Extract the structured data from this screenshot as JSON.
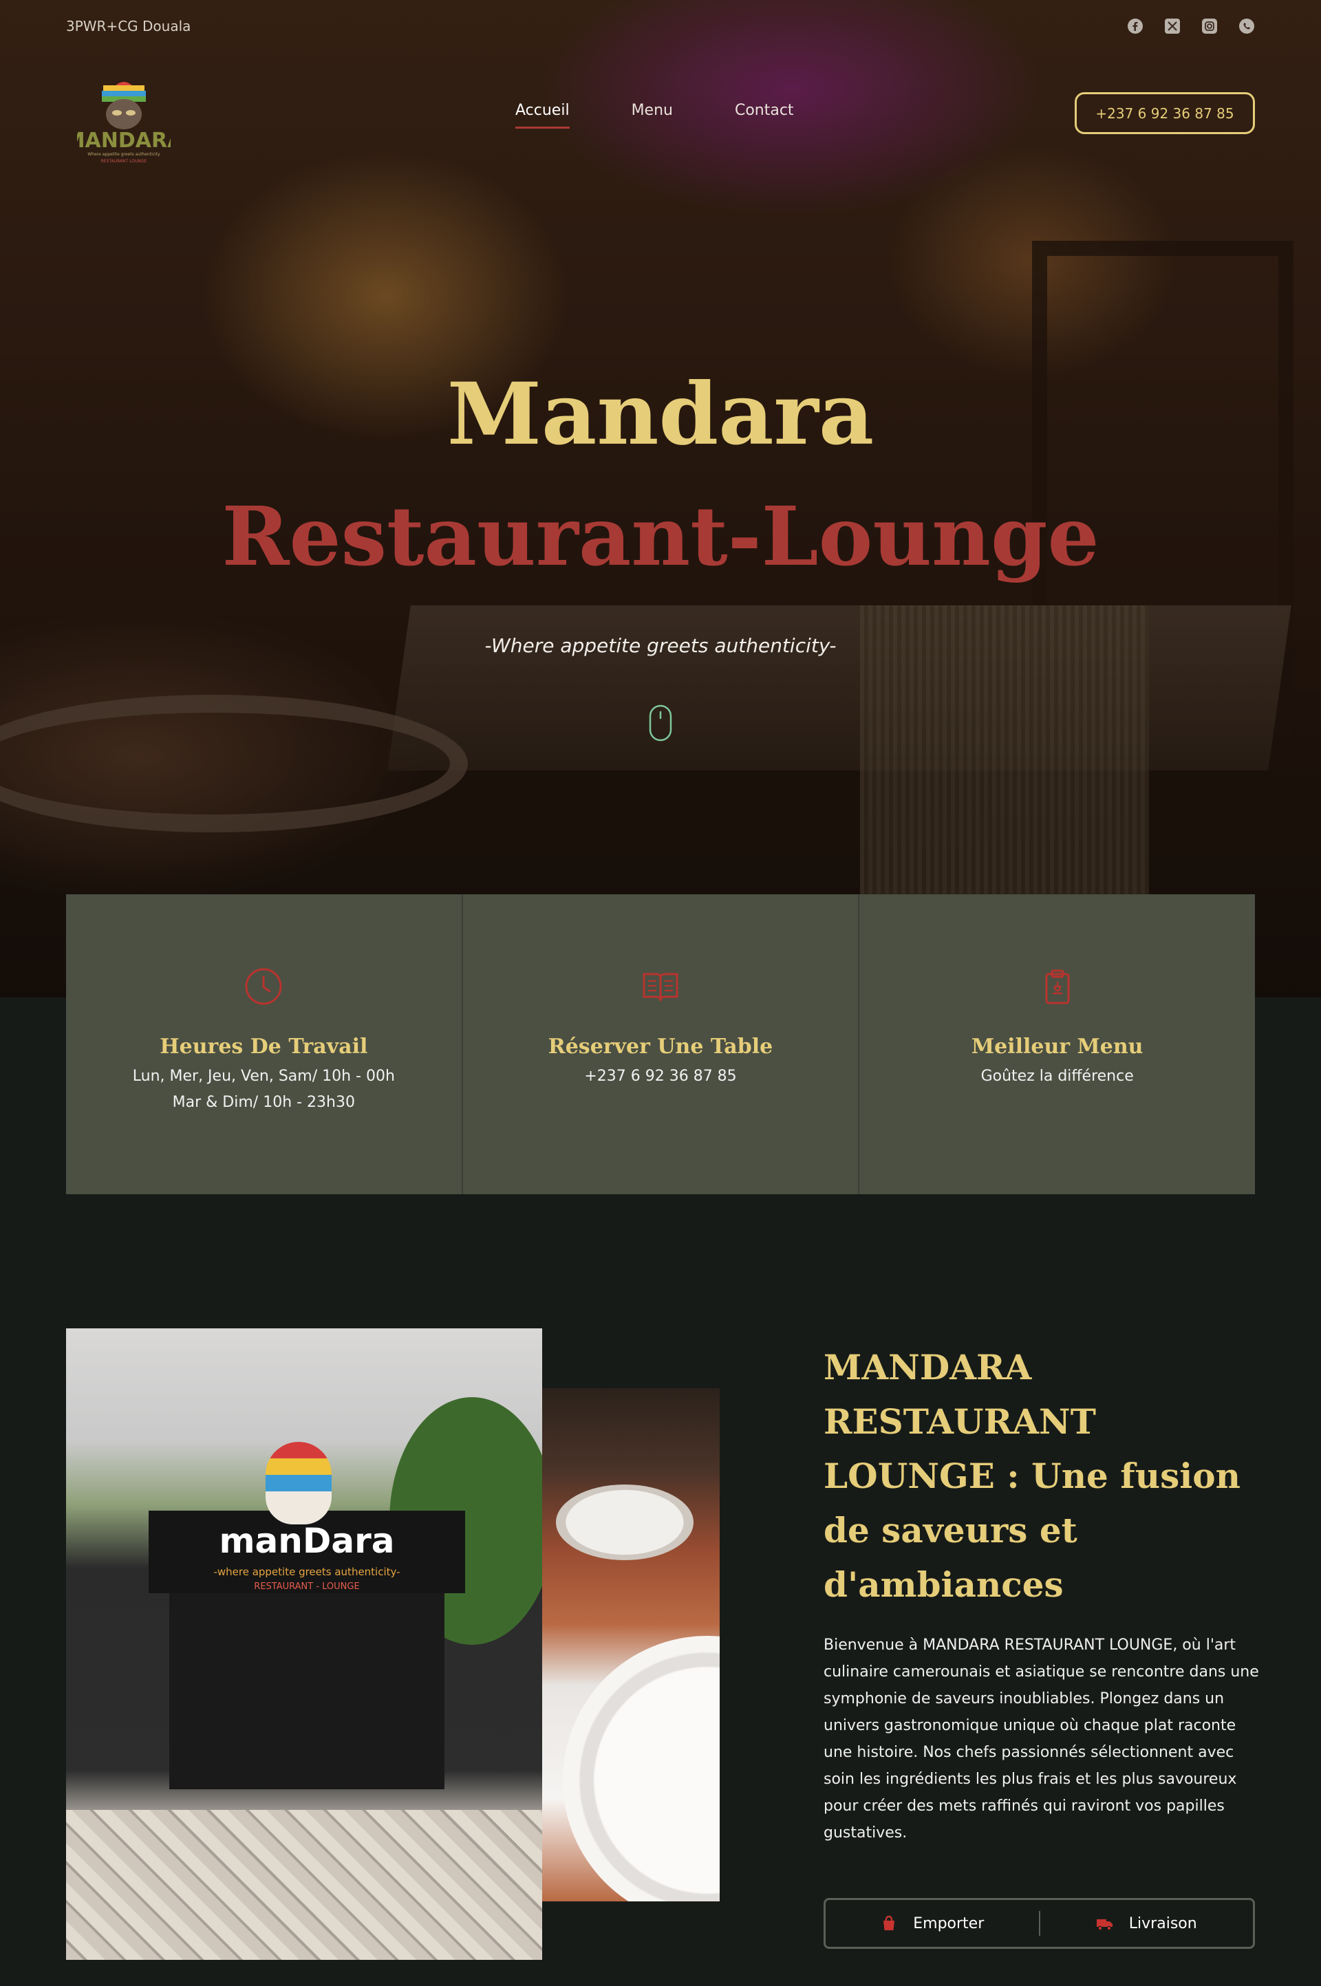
{
  "topbar": {
    "address": "3PWR+CG Douala",
    "socials": [
      "facebook-icon",
      "x-icon",
      "instagram-icon",
      "whatsapp-icon"
    ]
  },
  "logo": {
    "alt": "MANDARA",
    "sub": "Where appetite greets authenticity",
    "sub2": "RESTAURANT LOUNGE"
  },
  "nav": {
    "items": [
      {
        "label": "Accueil",
        "active": true
      },
      {
        "label": "Menu",
        "active": false
      },
      {
        "label": "Contact",
        "active": false
      }
    ],
    "phone_button": "+237 6 92 36 87 85"
  },
  "hero": {
    "title": "Mandara",
    "subtitle": "Restaurant-Lounge",
    "tagline": "-Where appetite greets authenticity-"
  },
  "info_boxes": [
    {
      "icon": "clock-icon",
      "title": "Heures De Travail",
      "lines": [
        "Lun, Mer, Jeu, Ven, Sam/ 10h - 00h",
        "Mar & Dim/ 10h - 23h30"
      ]
    },
    {
      "icon": "book-icon",
      "title": "Réserver Une Table",
      "lines": [
        "+237 6 92 36 87 85"
      ]
    },
    {
      "icon": "menu-clipboard-icon",
      "title": "Meilleur Menu",
      "lines": [
        "Goûtez la différence"
      ]
    }
  ],
  "about": {
    "title": "MANDARA RESTAURANT LOUNGE : Une fusion de saveurs et d'ambiances",
    "text": "Bienvenue à MANDARA RESTAURANT LOUNGE, où l'art culinaire camerounais et asiatique se rencontre dans une symphonie de saveurs inoubliables. Plongez dans un univers gastronomique unique où chaque plat raconte une histoire. Nos chefs passionnés sélectionnent avec soin les ingrédients les plus frais et les plus savoureux pour créer des mets raffinés qui raviront vos papilles gustatives.",
    "photo_sign": {
      "name": "manDara",
      "tag": "-where appetite greets authenticity-",
      "sub": "RESTAURANT - LOUNGE"
    }
  },
  "actions": [
    {
      "icon": "bag-icon",
      "label": "Emporter"
    },
    {
      "icon": "truck-icon",
      "label": "Livraison"
    }
  ],
  "colors": {
    "gold": "#e6cd79",
    "red": "#a83a35",
    "panel": "#4b5043",
    "background": "#171b18"
  }
}
